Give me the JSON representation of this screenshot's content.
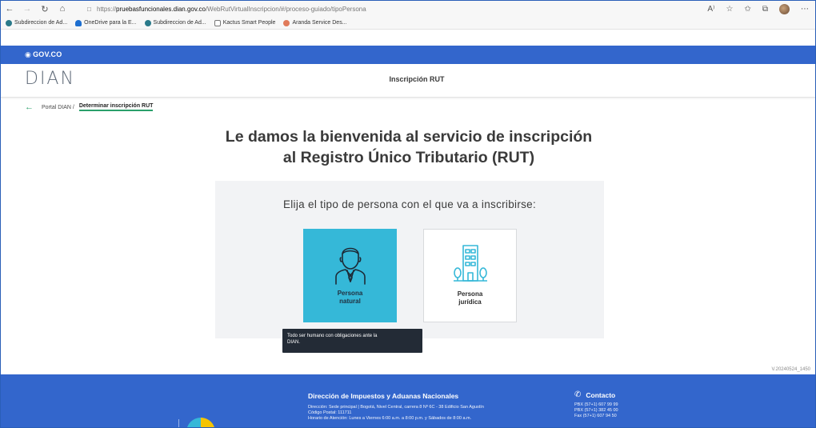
{
  "browser": {
    "url_domain_prefix": "https://",
    "url_domain": "pruebasfuncionales.dian.gov.co",
    "url_path": "/WebRutVirtualInscripcion/#/proceso-guiado/tipoPersona",
    "icons": [
      "back-icon",
      "forward-icon",
      "refresh-icon",
      "home-icon",
      "lock-icon",
      "read-aloud-icon",
      "favorite-icon",
      "favorites-icon",
      "collections-icon",
      "profile-avatar",
      "more-icon"
    ]
  },
  "favorites": [
    {
      "label": "Subdireccion de Ad...",
      "color": "#2a7a8a"
    },
    {
      "label": "OneDrive para la E...",
      "color": "#1e6fd0"
    },
    {
      "label": "Subdireccion de Ad...",
      "color": "#2a7a8a"
    },
    {
      "label": "Kactus Smart People",
      "color": "#888888"
    },
    {
      "label": "Aranda Service Des...",
      "color": "#e07a5a"
    }
  ],
  "gov": {
    "label": "GOV.CO"
  },
  "header": {
    "logo": "DIAN",
    "title": "Inscripción RUT"
  },
  "breadcrumb": {
    "parent": "Portal DIAN /",
    "current": "Determinar inscripción RUT"
  },
  "main": {
    "welcome_line1": "Le damos la bienvenida al servicio de inscripción",
    "welcome_line2": "al Registro Único Tributario (RUT)",
    "question": "Elija el tipo de persona con el que va a inscribirse:",
    "options": [
      {
        "line1": "Persona",
        "line2": "natural"
      },
      {
        "line1": "Persona",
        "line2": "jurídica"
      }
    ],
    "tooltip_line1": "Todo ser humano con obligaciones ante la",
    "tooltip_line2": "DIAN."
  },
  "version": "V.20240524_1450",
  "footer": {
    "title": "Dirección de Impuestos y Aduanas Nacionales",
    "address": "Dirección: Sede principal | Bogotá, Nivel Central, carrera 8 Nº 6C - 38 Edificio San Agustín",
    "postal": "Código Postal: 111711",
    "hours": "Horario de Atención: Lunes a Viernes 6:00 a.m. a 8:00 p.m. y Sábados de 8:00 a.m.",
    "contact_title": "Contacto",
    "pbx1": "PBX (57+1) 607 99 99",
    "pbx2": "PBX (57+1) 382 45 00",
    "fax": "Fax (57+1) 607 94 50"
  },
  "colors": {
    "gov_blue": "#3366cc",
    "card_selected": "#35b8d8",
    "accent_green": "#2aa06b",
    "tooltip_bg": "#232b36"
  }
}
